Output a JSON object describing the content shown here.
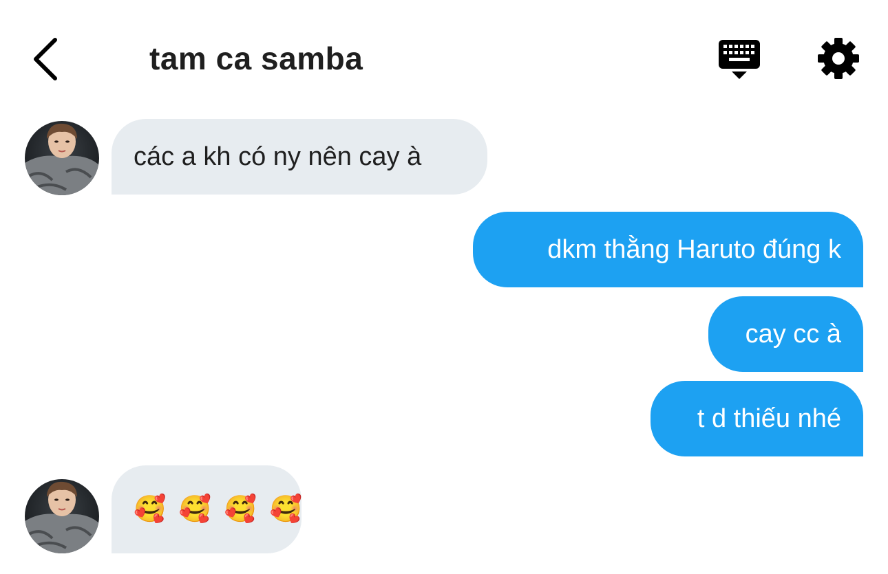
{
  "header": {
    "title": "tam ca samba",
    "back_icon": "chevron-left-icon",
    "keyboard_icon": "keyboard-icon",
    "settings_icon": "gear-icon"
  },
  "colors": {
    "incoming_bubble": "#e7ecf0",
    "outgoing_bubble": "#1da1f2",
    "text_dark": "#1f1f1f"
  },
  "messages": [
    {
      "direction": "incoming",
      "text": "các a kh có ny nên cay à"
    },
    {
      "direction": "outgoing",
      "text": "dkm thằng Haruto đúng k"
    },
    {
      "direction": "outgoing",
      "text": "cay cc à"
    },
    {
      "direction": "outgoing",
      "text": "t d thiếu nhé"
    },
    {
      "direction": "incoming",
      "text": "🥰 🥰 🥰 🥰"
    }
  ]
}
